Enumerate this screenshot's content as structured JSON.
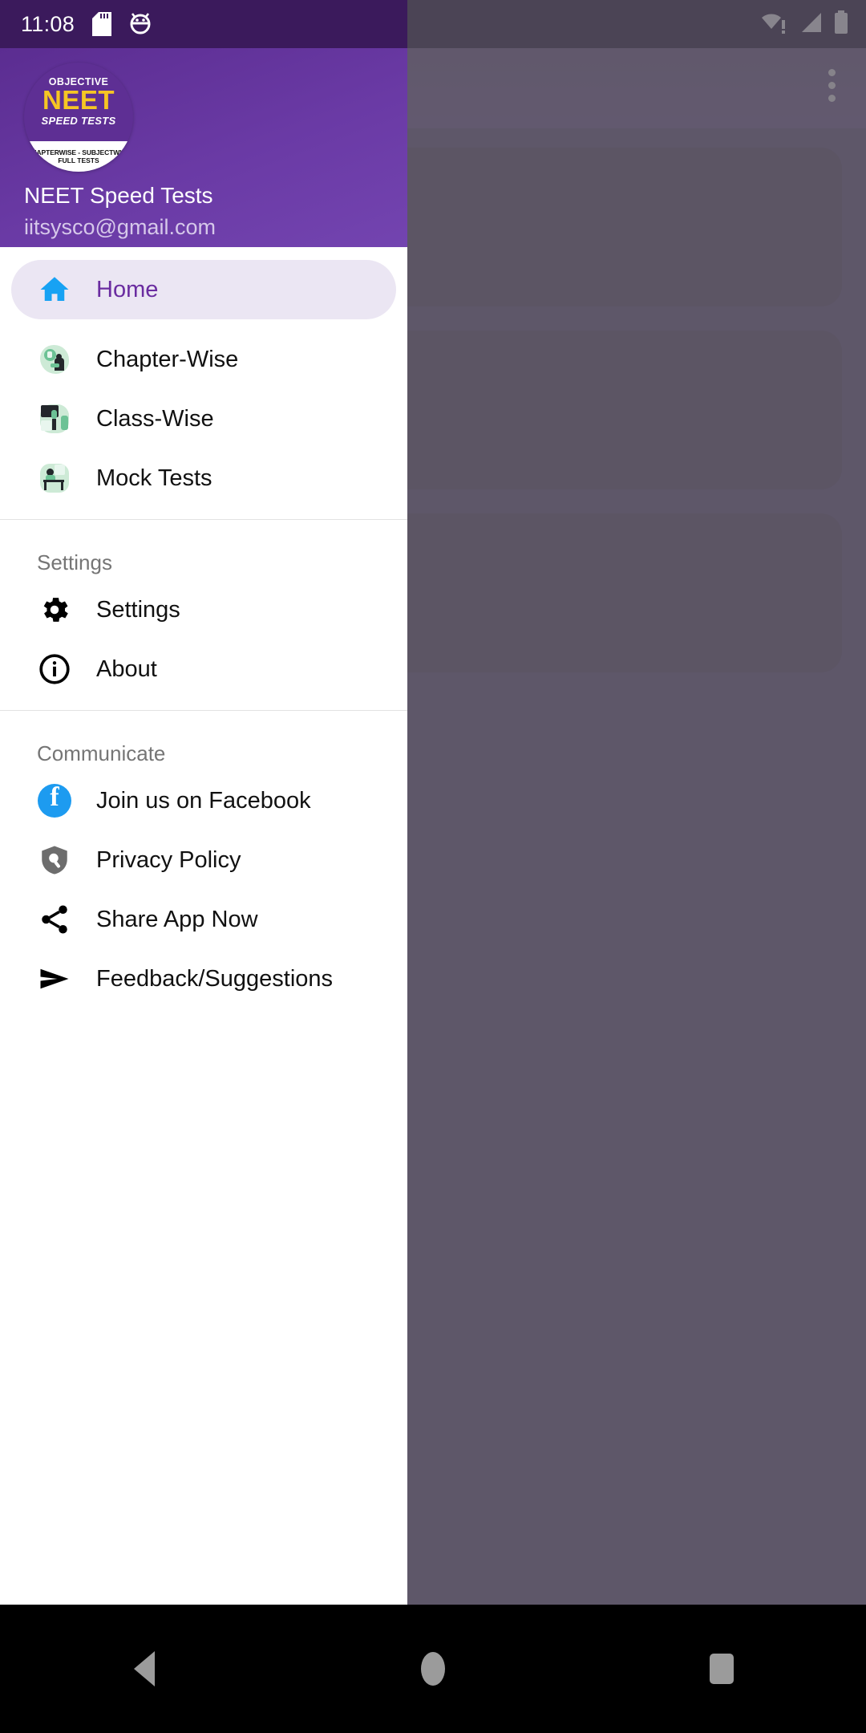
{
  "status_bar": {
    "time": "11:08",
    "icons": [
      "sd-card-icon",
      "android-debug-icon"
    ],
    "right_icons": [
      "wifi-warning-icon",
      "cellular-signal-icon",
      "battery-full-icon"
    ]
  },
  "background_app": {
    "overflow_menu": "overflow-menu-icon",
    "cards": [
      "card-1",
      "card-2",
      "card-3"
    ]
  },
  "drawer": {
    "logo": {
      "line1": "OBJECTIVE",
      "line2": "NEET",
      "line3": "SPEED TESTS",
      "footer1": "CHAPTERWISE - SUBJECTWISE",
      "footer2": "FULL TESTS"
    },
    "account_name": "NEET Speed Tests",
    "account_email": "iitsysco@gmail.com",
    "main_items": [
      {
        "label": "Home",
        "icon": "home-icon",
        "selected": true
      },
      {
        "label": "Chapter-Wise",
        "icon": "chapter-wise-illustration-icon",
        "selected": false
      },
      {
        "label": "Class-Wise",
        "icon": "class-wise-illustration-icon",
        "selected": false
      },
      {
        "label": "Mock Tests",
        "icon": "mock-tests-illustration-icon",
        "selected": false
      }
    ],
    "settings_section": {
      "title": "Settings",
      "items": [
        {
          "label": "Settings",
          "icon": "gear-icon"
        },
        {
          "label": "About",
          "icon": "info-circle-icon"
        }
      ]
    },
    "communicate_section": {
      "title": "Communicate",
      "items": [
        {
          "label": "Join us on Facebook",
          "icon": "facebook-icon"
        },
        {
          "label": "Privacy Policy",
          "icon": "shield-search-icon"
        },
        {
          "label": "Share App Now",
          "icon": "share-icon"
        },
        {
          "label": "Feedback/Suggestions",
          "icon": "send-icon"
        }
      ]
    }
  },
  "navigation_bar": {
    "back": "back-triangle-icon",
    "home": "home-circle-icon",
    "recents": "recents-square-icon"
  },
  "colors": {
    "drawer_header": "#6a3aa5",
    "selected_item_bg": "#ebe6f3",
    "selected_item_text": "#6a2ca0",
    "home_icon": "#17a2f3",
    "facebook_blue": "#1d9bf0",
    "logo_yellow": "#f6c623",
    "card_dark": "#1e0b34"
  }
}
